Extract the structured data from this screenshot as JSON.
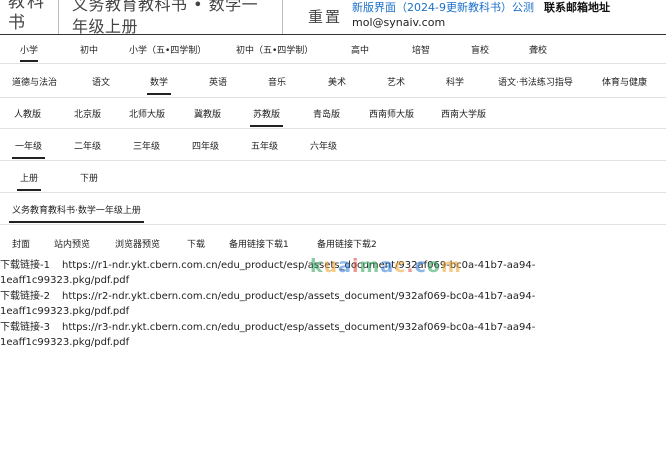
{
  "header": {
    "logo": "教科书",
    "title": "义务教育教科书 • 数学一年级上册",
    "reset": "重置",
    "new_link": "新版界面（2024-9更新教科书）公测",
    "contact_label": "联系邮箱地址",
    "email": "mol@synaiv.com"
  },
  "levels": [
    "小学",
    "初中",
    "小学（五•四学制）",
    "初中（五•四学制）",
    "高中",
    "培智",
    "盲校",
    "聋校"
  ],
  "subjects": [
    "道德与法治",
    "语文",
    "数学",
    "英语",
    "音乐",
    "美术",
    "艺术",
    "科学",
    "语文·书法练习指导",
    "体育与健康"
  ],
  "publishers": [
    "人教版",
    "北京版",
    "北师大版",
    "冀教版",
    "苏教版",
    "青岛版",
    "西南师大版",
    "西南大学版"
  ],
  "grades": [
    "一年级",
    "二年级",
    "三年级",
    "四年级",
    "五年级",
    "六年级"
  ],
  "terms": [
    "上册",
    "下册"
  ],
  "book": "义务教育教科书·数学一年级上册",
  "actions": [
    "封面",
    "站内预览",
    "浏览器预览",
    "下载",
    "备用链接下载1",
    "备用链接下载2"
  ],
  "downloads": [
    {
      "label": "下载链接-1",
      "url_line1": "https://r1-ndr.ykt.cbern.com.cn/edu_product/esp/assets_document/932af069-bc0a-41b7-aa94-",
      "url_line2": "1eaff1c99323.pkg/pdf.pdf"
    },
    {
      "label": "下载链接-2",
      "url_line1": "https://r2-ndr.ykt.cbern.com.cn/edu_product/esp/assets_document/932af069-bc0a-41b7-aa94-",
      "url_line2": "1eaff1c99323.pkg/pdf.pdf"
    },
    {
      "label": "下载链接-3",
      "url_line1": "https://r3-ndr.ykt.cbern.com.cn/edu_product/esp/assets_document/932af069-bc0a-41b7-aa94-",
      "url_line2": "1eaff1c99323.pkg/pdf.pdf"
    }
  ],
  "watermark": "kuaimac.com",
  "colors": {
    "link": "#1b6fc8",
    "active_underline": "#222222"
  }
}
